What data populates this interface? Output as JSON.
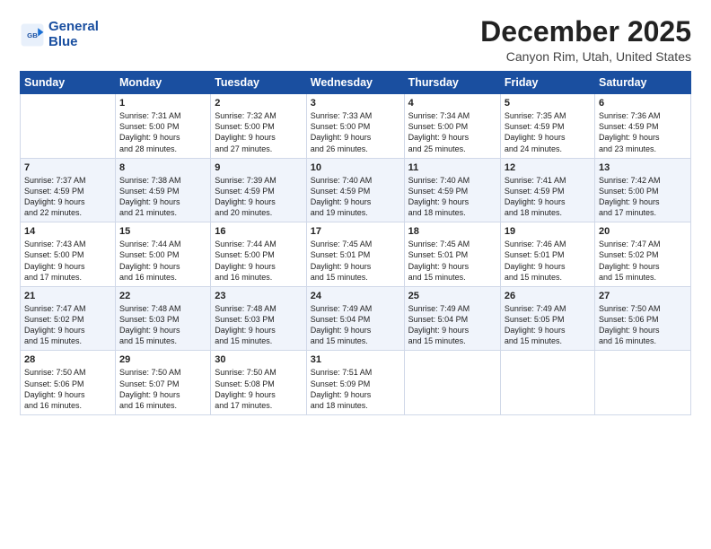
{
  "header": {
    "logo_line1": "General",
    "logo_line2": "Blue",
    "month": "December 2025",
    "location": "Canyon Rim, Utah, United States"
  },
  "weekdays": [
    "Sunday",
    "Monday",
    "Tuesday",
    "Wednesday",
    "Thursday",
    "Friday",
    "Saturday"
  ],
  "weeks": [
    [
      {
        "num": "",
        "info": ""
      },
      {
        "num": "1",
        "info": "Sunrise: 7:31 AM\nSunset: 5:00 PM\nDaylight: 9 hours\nand 28 minutes."
      },
      {
        "num": "2",
        "info": "Sunrise: 7:32 AM\nSunset: 5:00 PM\nDaylight: 9 hours\nand 27 minutes."
      },
      {
        "num": "3",
        "info": "Sunrise: 7:33 AM\nSunset: 5:00 PM\nDaylight: 9 hours\nand 26 minutes."
      },
      {
        "num": "4",
        "info": "Sunrise: 7:34 AM\nSunset: 5:00 PM\nDaylight: 9 hours\nand 25 minutes."
      },
      {
        "num": "5",
        "info": "Sunrise: 7:35 AM\nSunset: 4:59 PM\nDaylight: 9 hours\nand 24 minutes."
      },
      {
        "num": "6",
        "info": "Sunrise: 7:36 AM\nSunset: 4:59 PM\nDaylight: 9 hours\nand 23 minutes."
      }
    ],
    [
      {
        "num": "7",
        "info": "Sunrise: 7:37 AM\nSunset: 4:59 PM\nDaylight: 9 hours\nand 22 minutes."
      },
      {
        "num": "8",
        "info": "Sunrise: 7:38 AM\nSunset: 4:59 PM\nDaylight: 9 hours\nand 21 minutes."
      },
      {
        "num": "9",
        "info": "Sunrise: 7:39 AM\nSunset: 4:59 PM\nDaylight: 9 hours\nand 20 minutes."
      },
      {
        "num": "10",
        "info": "Sunrise: 7:40 AM\nSunset: 4:59 PM\nDaylight: 9 hours\nand 19 minutes."
      },
      {
        "num": "11",
        "info": "Sunrise: 7:40 AM\nSunset: 4:59 PM\nDaylight: 9 hours\nand 18 minutes."
      },
      {
        "num": "12",
        "info": "Sunrise: 7:41 AM\nSunset: 4:59 PM\nDaylight: 9 hours\nand 18 minutes."
      },
      {
        "num": "13",
        "info": "Sunrise: 7:42 AM\nSunset: 5:00 PM\nDaylight: 9 hours\nand 17 minutes."
      }
    ],
    [
      {
        "num": "14",
        "info": "Sunrise: 7:43 AM\nSunset: 5:00 PM\nDaylight: 9 hours\nand 17 minutes."
      },
      {
        "num": "15",
        "info": "Sunrise: 7:44 AM\nSunset: 5:00 PM\nDaylight: 9 hours\nand 16 minutes."
      },
      {
        "num": "16",
        "info": "Sunrise: 7:44 AM\nSunset: 5:00 PM\nDaylight: 9 hours\nand 16 minutes."
      },
      {
        "num": "17",
        "info": "Sunrise: 7:45 AM\nSunset: 5:01 PM\nDaylight: 9 hours\nand 15 minutes."
      },
      {
        "num": "18",
        "info": "Sunrise: 7:45 AM\nSunset: 5:01 PM\nDaylight: 9 hours\nand 15 minutes."
      },
      {
        "num": "19",
        "info": "Sunrise: 7:46 AM\nSunset: 5:01 PM\nDaylight: 9 hours\nand 15 minutes."
      },
      {
        "num": "20",
        "info": "Sunrise: 7:47 AM\nSunset: 5:02 PM\nDaylight: 9 hours\nand 15 minutes."
      }
    ],
    [
      {
        "num": "21",
        "info": "Sunrise: 7:47 AM\nSunset: 5:02 PM\nDaylight: 9 hours\nand 15 minutes."
      },
      {
        "num": "22",
        "info": "Sunrise: 7:48 AM\nSunset: 5:03 PM\nDaylight: 9 hours\nand 15 minutes."
      },
      {
        "num": "23",
        "info": "Sunrise: 7:48 AM\nSunset: 5:03 PM\nDaylight: 9 hours\nand 15 minutes."
      },
      {
        "num": "24",
        "info": "Sunrise: 7:49 AM\nSunset: 5:04 PM\nDaylight: 9 hours\nand 15 minutes."
      },
      {
        "num": "25",
        "info": "Sunrise: 7:49 AM\nSunset: 5:04 PM\nDaylight: 9 hours\nand 15 minutes."
      },
      {
        "num": "26",
        "info": "Sunrise: 7:49 AM\nSunset: 5:05 PM\nDaylight: 9 hours\nand 15 minutes."
      },
      {
        "num": "27",
        "info": "Sunrise: 7:50 AM\nSunset: 5:06 PM\nDaylight: 9 hours\nand 16 minutes."
      }
    ],
    [
      {
        "num": "28",
        "info": "Sunrise: 7:50 AM\nSunset: 5:06 PM\nDaylight: 9 hours\nand 16 minutes."
      },
      {
        "num": "29",
        "info": "Sunrise: 7:50 AM\nSunset: 5:07 PM\nDaylight: 9 hours\nand 16 minutes."
      },
      {
        "num": "30",
        "info": "Sunrise: 7:50 AM\nSunset: 5:08 PM\nDaylight: 9 hours\nand 17 minutes."
      },
      {
        "num": "31",
        "info": "Sunrise: 7:51 AM\nSunset: 5:09 PM\nDaylight: 9 hours\nand 18 minutes."
      },
      {
        "num": "",
        "info": ""
      },
      {
        "num": "",
        "info": ""
      },
      {
        "num": "",
        "info": ""
      }
    ]
  ]
}
